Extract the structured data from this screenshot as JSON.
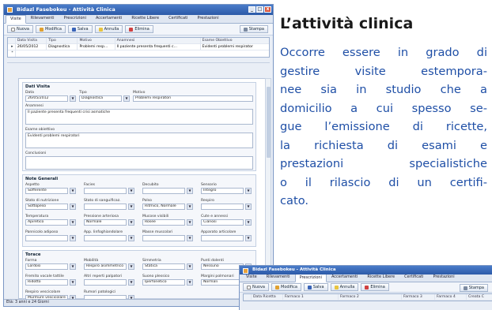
{
  "main_window": {
    "title": "Bidazl Fasebokeu - Attività Clinica",
    "window_buttons": [
      "_",
      "□",
      "x"
    ],
    "tabs": [
      "Visite",
      "Rilevamenti",
      "Prescrizioni",
      "Accertamenti",
      "Ricette Libere",
      "Certificati",
      "Prestazioni"
    ],
    "active_tab": "Visite",
    "toolbar": {
      "new_label": "Nuova",
      "edit_label": "Modifica",
      "save_label": "Salva",
      "cancel_label": "Annulla",
      "delete_label": "Elimina",
      "print_label": "Stampa"
    },
    "grid": {
      "columns": [
        "Data Visita",
        "Tipo",
        "Motivo",
        "Anamnesi",
        "Esame Obiettivo"
      ],
      "rows": [
        [
          "26/05/2012",
          "Diagnostica",
          "Problemi resp...",
          "Il paziente presenta frequenti c...",
          "Evidenti problemi respirator"
        ]
      ]
    },
    "dati_visita": {
      "title": "Dati Visita",
      "data_label": "Data",
      "data_value": "26/05/2012",
      "tipo_label": "Tipo",
      "tipo_value": "Diagnostica",
      "motivo_label": "Motivo",
      "motivo_value": "Problemi respiratori",
      "anamnesi_label": "Anamnesi",
      "anamnesi_value": "Il paziente presenta frequenti crisi asmatiche",
      "esame_label": "Esame obiettivo",
      "esame_value": "Evidenti problemi respiratori",
      "conclusioni_label": "Conclusioni",
      "conclusioni_value": ""
    },
    "note_generali": {
      "title": "Note Generali",
      "rows": [
        [
          {
            "label": "Aspetto",
            "value": "Sofferente"
          },
          {
            "label": "Facies",
            "value": ""
          },
          {
            "label": "Decubito",
            "value": ""
          },
          {
            "label": "Sensorio",
            "value": "Integro"
          }
        ],
        [
          {
            "label": "Stato di nutrizione",
            "value": "Sottopeso"
          },
          {
            "label": "Stato di sanguificaz.",
            "value": ""
          },
          {
            "label": "Polso",
            "value": "Ritmico, Normale"
          },
          {
            "label": "Respiro",
            "value": ""
          }
        ],
        [
          {
            "label": "Temperatura",
            "value": "Apiretico"
          },
          {
            "label": "Pressione arteriosa",
            "value": "Normale"
          },
          {
            "label": "Mucose visibili",
            "value": "Rosee"
          },
          {
            "label": "Cute e annessi",
            "value": "Cianosi"
          }
        ],
        [
          {
            "label": "Pannicolo adiposo",
            "value": ""
          },
          {
            "label": "App. linfoghiandolare",
            "value": ""
          },
          {
            "label": "Masse muscolari",
            "value": ""
          },
          {
            "label": "Apparato articolare",
            "value": ""
          }
        ]
      ]
    },
    "torace": {
      "title": "Torace",
      "rows": [
        [
          {
            "label": "Forma",
            "value": "Lordosi"
          },
          {
            "label": "Mobilità",
            "value": "Respiro asimmetrico"
          },
          {
            "label": "Simmetria",
            "value": "Statica"
          },
          {
            "label": "Punti dolenti",
            "value": "Nessuno"
          }
        ],
        [
          {
            "label": "Fremito vocale tattile",
            "value": "Ridotto"
          },
          {
            "label": "Altri reperti palpatori",
            "value": ""
          },
          {
            "label": "Suono plessico",
            "value": "Iperfonetico"
          },
          {
            "label": "Margini polmonari",
            "value": "Normali"
          }
        ],
        [
          {
            "label": "Respiro vescicolare",
            "value": "Murmure vescicolare"
          },
          {
            "label": "Rumori patologici",
            "value": ""
          },
          {
            "label": "",
            "value": ""
          },
          {
            "label": "",
            "value": ""
          }
        ]
      ]
    },
    "status_text": "Età: 3 anni e 24 Giorni"
  },
  "second_window": {
    "title": "Bidazl Fasebokeu - Attività Clinica",
    "tabs": [
      "Visite",
      "Rilevamenti",
      "Prescrizioni",
      "Accertamenti",
      "Ricette Libere",
      "Certificati",
      "Prestazioni"
    ],
    "active_tab": "Prescrizioni",
    "toolbar": {
      "new_label": "Nuova",
      "edit_label": "Modifica",
      "save_label": "Salva",
      "cancel_label": "Annulla",
      "delete_label": "Elimina",
      "print_label": "Stampa"
    },
    "grid_columns": [
      "Data Ricetta",
      "Farmaco 1",
      "Farmaco 2",
      "Farmaco 3",
      "Farmaco 4",
      "Creata C"
    ]
  },
  "text": {
    "heading": "L’attività clinica",
    "lines": [
      "Occorre essere in grado di",
      "gestire visite estempora-",
      "nee sia in studio che a",
      "domicilio a cui spesso se-",
      "gue l’emissione di ricette,",
      "la richiesta di esami e",
      "prestazioni specialistiche",
      "o il rilascio di un certifi-",
      "cato."
    ]
  },
  "colors": {
    "text_blue": "#1f4fa6",
    "title_bar": "#2c5aa8",
    "window_bg": "#e9eef6"
  }
}
